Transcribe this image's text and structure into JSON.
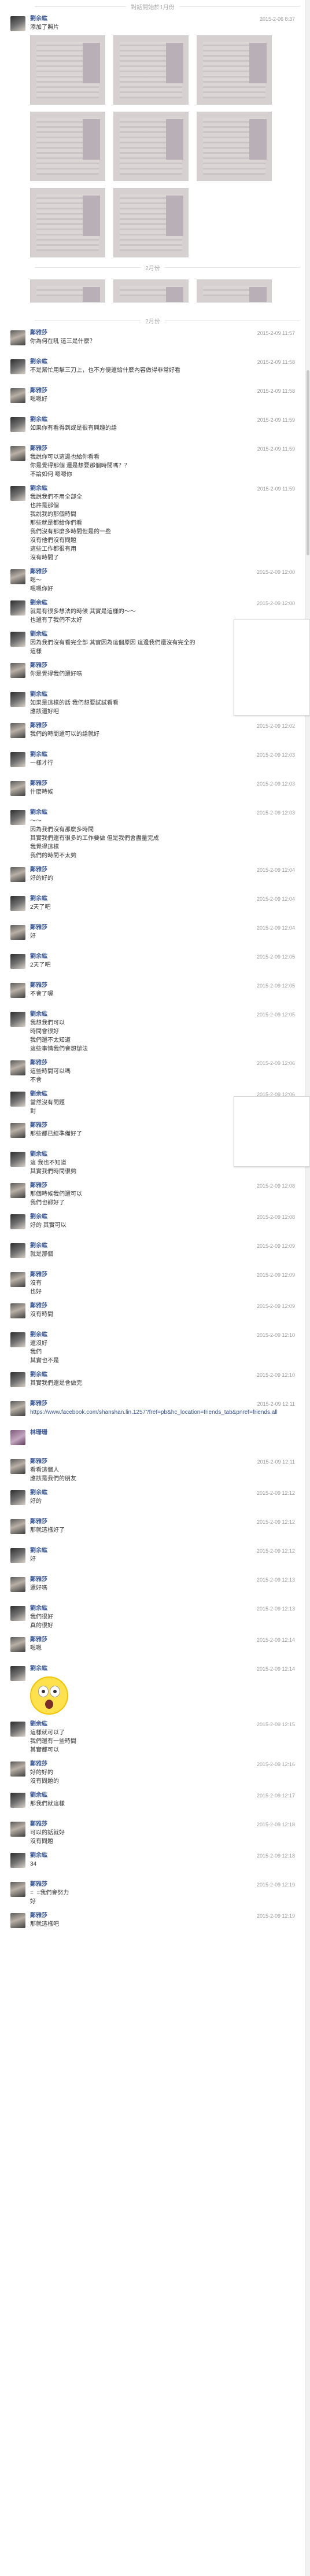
{
  "top_date": "對話開始於1月份",
  "separators": [
    "2月份",
    "2月份"
  ],
  "photo_count_row1": 6,
  "photo_count_row2": 6,
  "messages": [
    {
      "name": "劉余紘",
      "time": "2015-2-06 8:37",
      "photos": "row1",
      "lines": [
        "添加了照片"
      ]
    },
    {
      "name": "",
      "time": "",
      "photos": "row2",
      "lines": []
    },
    {
      "name": "鄭雅莎",
      "time": "2015-2-09 11:57",
      "lines": [
        "你為何在吼 這三是什麼？"
      ]
    },
    {
      "name": "劉余紘",
      "time": "2015-2-09 11:58",
      "lines": [
        "不是幫忙用擊三刀上，也不方便還給什麼內容做得非常好看"
      ]
    },
    {
      "name": "鄭雅莎",
      "time": "2015-2-09 11:58",
      "lines": [
        "嗯嗯好"
      ]
    },
    {
      "name": "劉余紘",
      "time": "2015-2-09 11:59",
      "lines": [
        "如果你有看得到或是很有興趣的話"
      ]
    },
    {
      "name": "鄭雅莎",
      "time": "2015-2-09 11:59",
      "lines": [
        "我說你可以這邊也給你看看",
        "你是覺得那個 還是想要那個時間嗎？？",
        "不論如何 嗯嗯你"
      ]
    },
    {
      "name": "劉余紘",
      "time": "2015-2-09 11:59",
      "lines": [
        "我說我們不用全部全",
        "也許是那個",
        "我說我的那個時間",
        "那些就是都給你們看",
        "我們沒有那麼多時間但是的一些",
        "沒有他們沒有問題",
        "這些工作都很有用",
        "沒有時間了"
      ]
    },
    {
      "name": "鄭雅莎",
      "time": "2015-2-09 12:00",
      "lines": [
        "嗯～",
        "嗯嗯你好"
      ]
    },
    {
      "name": "劉余紘",
      "time": "2015-2-09 12:00",
      "lines": [
        "就是有很多想法的時候 其實是這樣的～～",
        "也還有了我們不太好"
      ]
    },
    {
      "name": "劉余紘",
      "time": "2015-2-09 12:01",
      "lines": [
        "因為我們沒有看完全部 其實因為這個原因 這邊我們還沒有完全的",
        "這樣"
      ]
    },
    {
      "name": "鄭雅莎",
      "time": "2015-2-09 12:01",
      "lines": [
        "你是覺得我們還好嗎"
      ]
    },
    {
      "name": "劉余紘",
      "time": "2015-2-09 12:02",
      "lines": [
        "如果是這樣的話 我們想要試試看看",
        "應該還好吧"
      ]
    },
    {
      "name": "鄭雅莎",
      "time": "2015-2-09 12:02",
      "lines": [
        "我們的時間還可以的話就好"
      ]
    },
    {
      "name": "劉余紘",
      "time": "2015-2-09 12:03",
      "lines": [
        "一樣才行"
      ]
    },
    {
      "name": "鄭雅莎",
      "time": "2015-2-09 12:03",
      "lines": [
        "什麼時候"
      ]
    },
    {
      "name": "劉余紘",
      "time": "2015-2-09 12:03",
      "lines": [
        "～～",
        "因為我們沒有那麼多時間",
        "其實我們還有很多的工作要做 但是我們會盡量完成",
        "我覺得這樣",
        "我們的時間不太夠"
      ]
    },
    {
      "name": "鄭雅莎",
      "time": "2015-2-09 12:04",
      "lines": [
        "好的好的"
      ]
    },
    {
      "name": "劉余紘",
      "time": "2015-2-09 12:04",
      "lines": [
        "2天了吧"
      ]
    },
    {
      "name": "鄭雅莎",
      "time": "2015-2-09 12:04",
      "lines": [
        "好"
      ]
    },
    {
      "name": "劉余紘",
      "time": "2015-2-09 12:05",
      "lines": [
        "2天了吧"
      ]
    },
    {
      "name": "鄭雅莎",
      "time": "2015-2-09 12:05",
      "lines": [
        "不會了喔"
      ]
    },
    {
      "name": "劉余紘",
      "time": "2015-2-09 12:05",
      "lines": [
        "我想我們可以",
        "時間會很好",
        "我們還不太知道",
        "這些事情我們會想辦法"
      ]
    },
    {
      "name": "鄭雅莎",
      "time": "2015-2-09 12:06",
      "lines": [
        "這些時間可以嗎",
        "不會"
      ]
    },
    {
      "name": "劉余紘",
      "time": "2015-2-09 12:06",
      "lines": [
        "當然沒有問題",
        "對"
      ]
    },
    {
      "name": "鄭雅莎",
      "time": "2015-2-09 12:07",
      "lines": [
        "那些都已經準備好了"
      ]
    },
    {
      "name": "劉余紘",
      "time": "2015-2-09 12:07",
      "lines": [
        "這 我也不知道",
        "其實我們時間很夠"
      ]
    },
    {
      "name": "鄭雅莎",
      "time": "2015-2-09 12:08",
      "lines": [
        "那個時候我們還可以",
        "我們也都好了"
      ]
    },
    {
      "name": "劉余紘",
      "time": "2015-2-09 12:08",
      "lines": [
        "好的 其實可以"
      ]
    },
    {
      "name": "劉余紘",
      "time": "2015-2-09 12:09",
      "lines": [
        "就是那個"
      ]
    },
    {
      "name": "鄭雅莎",
      "time": "2015-2-09 12:09",
      "lines": [
        "沒有",
        "也好"
      ]
    },
    {
      "name": "鄭雅莎",
      "time": "2015-2-09 12:09",
      "lines": [
        "沒有時間"
      ]
    },
    {
      "name": "劉余紘",
      "time": "2015-2-09 12:10",
      "lines": [
        "還沒好",
        "我們",
        "其實也不是"
      ]
    },
    {
      "name": "劉余紘",
      "time": "2015-2-09 12:10",
      "lines": [
        "其實我們還是會做完"
      ]
    },
    {
      "name": "鄭雅莎",
      "time": "2015-2-09 12:11",
      "lines": [
        "https://www.facebook.com/shanshan.lin.1257?fref=pb&hc_location=friends_tab&pnref=friends.all"
      ],
      "link": true
    },
    {
      "name": "林珊珊",
      "time": "",
      "lines": [],
      "third": true
    },
    {
      "name": "鄭雅莎",
      "time": "2015-2-09 12:11",
      "lines": [
        "看看這個人",
        "應該是我們的朋友"
      ]
    },
    {
      "name": "劉余紘",
      "time": "2015-2-09 12:12",
      "lines": [
        "好的"
      ]
    },
    {
      "name": "鄭雅莎",
      "time": "2015-2-09 12:12",
      "lines": [
        "那就這樣好了"
      ]
    },
    {
      "name": "劉余紘",
      "time": "2015-2-09 12:12",
      "lines": [
        "好"
      ]
    },
    {
      "name": "鄭雅莎",
      "time": "2015-2-09 12:13",
      "lines": [
        "還好嗎"
      ]
    },
    {
      "name": "劉余紘",
      "time": "2015-2-09 12:13",
      "lines": [
        "我們很好",
        "真的很好"
      ]
    },
    {
      "name": "鄭雅莎",
      "time": "2015-2-09 12:14",
      "lines": [
        "嗯嗯"
      ]
    },
    {
      "name": "劉余紘",
      "time": "2015-2-09 12:14",
      "lines": [],
      "sticker": true
    },
    {
      "name": "劉余紘",
      "time": "2015-2-09 12:15",
      "lines": [
        "這樣就可以了",
        "我們還有一些時間",
        "其實都可以"
      ]
    },
    {
      "name": "鄭雅莎",
      "time": "2015-2-09 12:16",
      "lines": [
        "好的好的",
        "沒有問題的"
      ]
    },
    {
      "name": "劉余紘",
      "time": "2015-2-09 12:17",
      "lines": [
        "那我們就這樣"
      ]
    },
    {
      "name": "鄭雅莎",
      "time": "2015-2-09 12:18",
      "lines": [
        "可以的話就好",
        "沒有問題"
      ]
    },
    {
      "name": "劉余紘",
      "time": "2015-2-09 12:18",
      "lines": [
        "34"
      ]
    },
    {
      "name": "鄭雅莎",
      "time": "2015-2-09 12:19",
      "lines": [
        "=  =我們會努力",
        "好"
      ]
    },
    {
      "name": "鄭雅莎",
      "time": "2015-2-09 12:19",
      "lines": [
        "那就這樣吧"
      ]
    }
  ]
}
